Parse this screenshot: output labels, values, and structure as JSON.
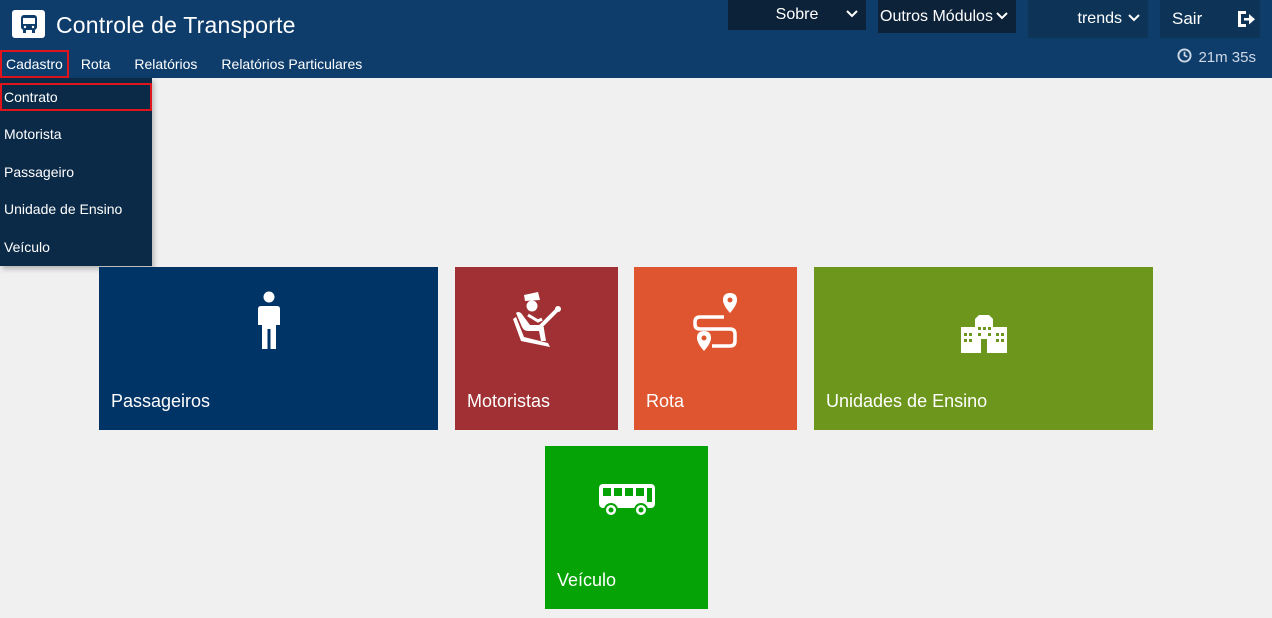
{
  "app": {
    "title": "Controle de Transporte",
    "logo_icon": "bus-icon"
  },
  "topbar": {
    "sobre": "Sobre",
    "outros_modulos": "Outros Módulos",
    "user": "trends",
    "sair": "Sair"
  },
  "timer": "21m 35s",
  "menu": [
    "Cadastro",
    "Rota",
    "Relatórios",
    "Relatórios Particulares"
  ],
  "dropdown": [
    "Contrato",
    "Motorista",
    "Passageiro",
    "Unidade de Ensino",
    "Veículo"
  ],
  "tiles": [
    {
      "label": "Passageiros",
      "icon": "person-icon",
      "color": "#003366"
    },
    {
      "label": "Motoristas",
      "icon": "driver-icon",
      "color": "#a03033"
    },
    {
      "label": "Rota",
      "icon": "route-icon",
      "color": "#de5530"
    },
    {
      "label": "Unidades de Ensino",
      "icon": "school-icon",
      "color": "#6c961c"
    },
    {
      "label": "Veículo",
      "icon": "bus-icon",
      "color": "#06a306"
    }
  ],
  "colors": {
    "header": "#0e3d6b",
    "highlight": "#e0141b",
    "background": "#f0f0f0"
  }
}
